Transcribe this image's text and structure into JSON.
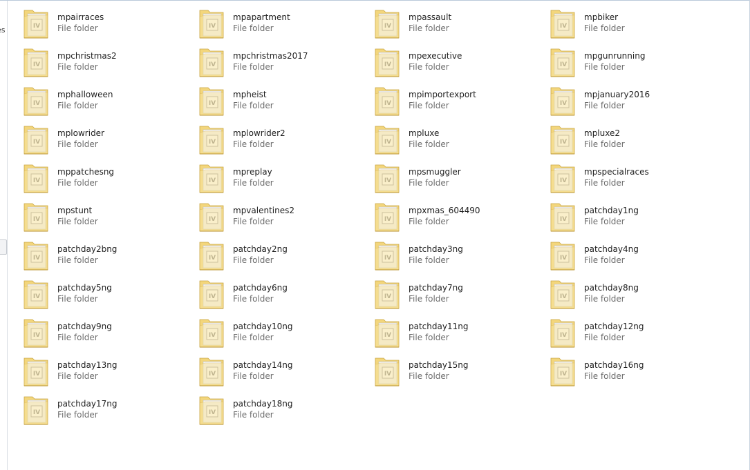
{
  "nav": {
    "partial_label": "es"
  },
  "type_label": "File folder",
  "items": [
    {
      "name": "mpairraces"
    },
    {
      "name": "mpapartment"
    },
    {
      "name": "mpassault"
    },
    {
      "name": "mpbiker"
    },
    {
      "name": "mpchristmas2"
    },
    {
      "name": "mpchristmas2017"
    },
    {
      "name": "mpexecutive"
    },
    {
      "name": "mpgunrunning"
    },
    {
      "name": "mphalloween"
    },
    {
      "name": "mpheist"
    },
    {
      "name": "mpimportexport"
    },
    {
      "name": "mpjanuary2016"
    },
    {
      "name": "mplowrider"
    },
    {
      "name": "mplowrider2"
    },
    {
      "name": "mpluxe"
    },
    {
      "name": "mpluxe2"
    },
    {
      "name": "mppatchesng"
    },
    {
      "name": "mpreplay"
    },
    {
      "name": "mpsmuggler"
    },
    {
      "name": "mpspecialraces"
    },
    {
      "name": "mpstunt"
    },
    {
      "name": "mpvalentines2"
    },
    {
      "name": "mpxmas_604490"
    },
    {
      "name": "patchday1ng"
    },
    {
      "name": "patchday2bng"
    },
    {
      "name": "patchday2ng"
    },
    {
      "name": "patchday3ng"
    },
    {
      "name": "patchday4ng"
    },
    {
      "name": "patchday5ng"
    },
    {
      "name": "patchday6ng"
    },
    {
      "name": "patchday7ng"
    },
    {
      "name": "patchday8ng"
    },
    {
      "name": "patchday9ng"
    },
    {
      "name": "patchday10ng"
    },
    {
      "name": "patchday11ng"
    },
    {
      "name": "patchday12ng"
    },
    {
      "name": "patchday13ng"
    },
    {
      "name": "patchday14ng"
    },
    {
      "name": "patchday15ng"
    },
    {
      "name": "patchday16ng"
    },
    {
      "name": "patchday17ng"
    },
    {
      "name": "patchday18ng"
    }
  ],
  "icon": {
    "name": "folder-icon",
    "badge_letter": "IV",
    "folder_color": "#f3d67c",
    "folder_front": "#f7e3a0",
    "paper_color": "#f4f4f4",
    "badge_color": "#7d7d7d"
  }
}
